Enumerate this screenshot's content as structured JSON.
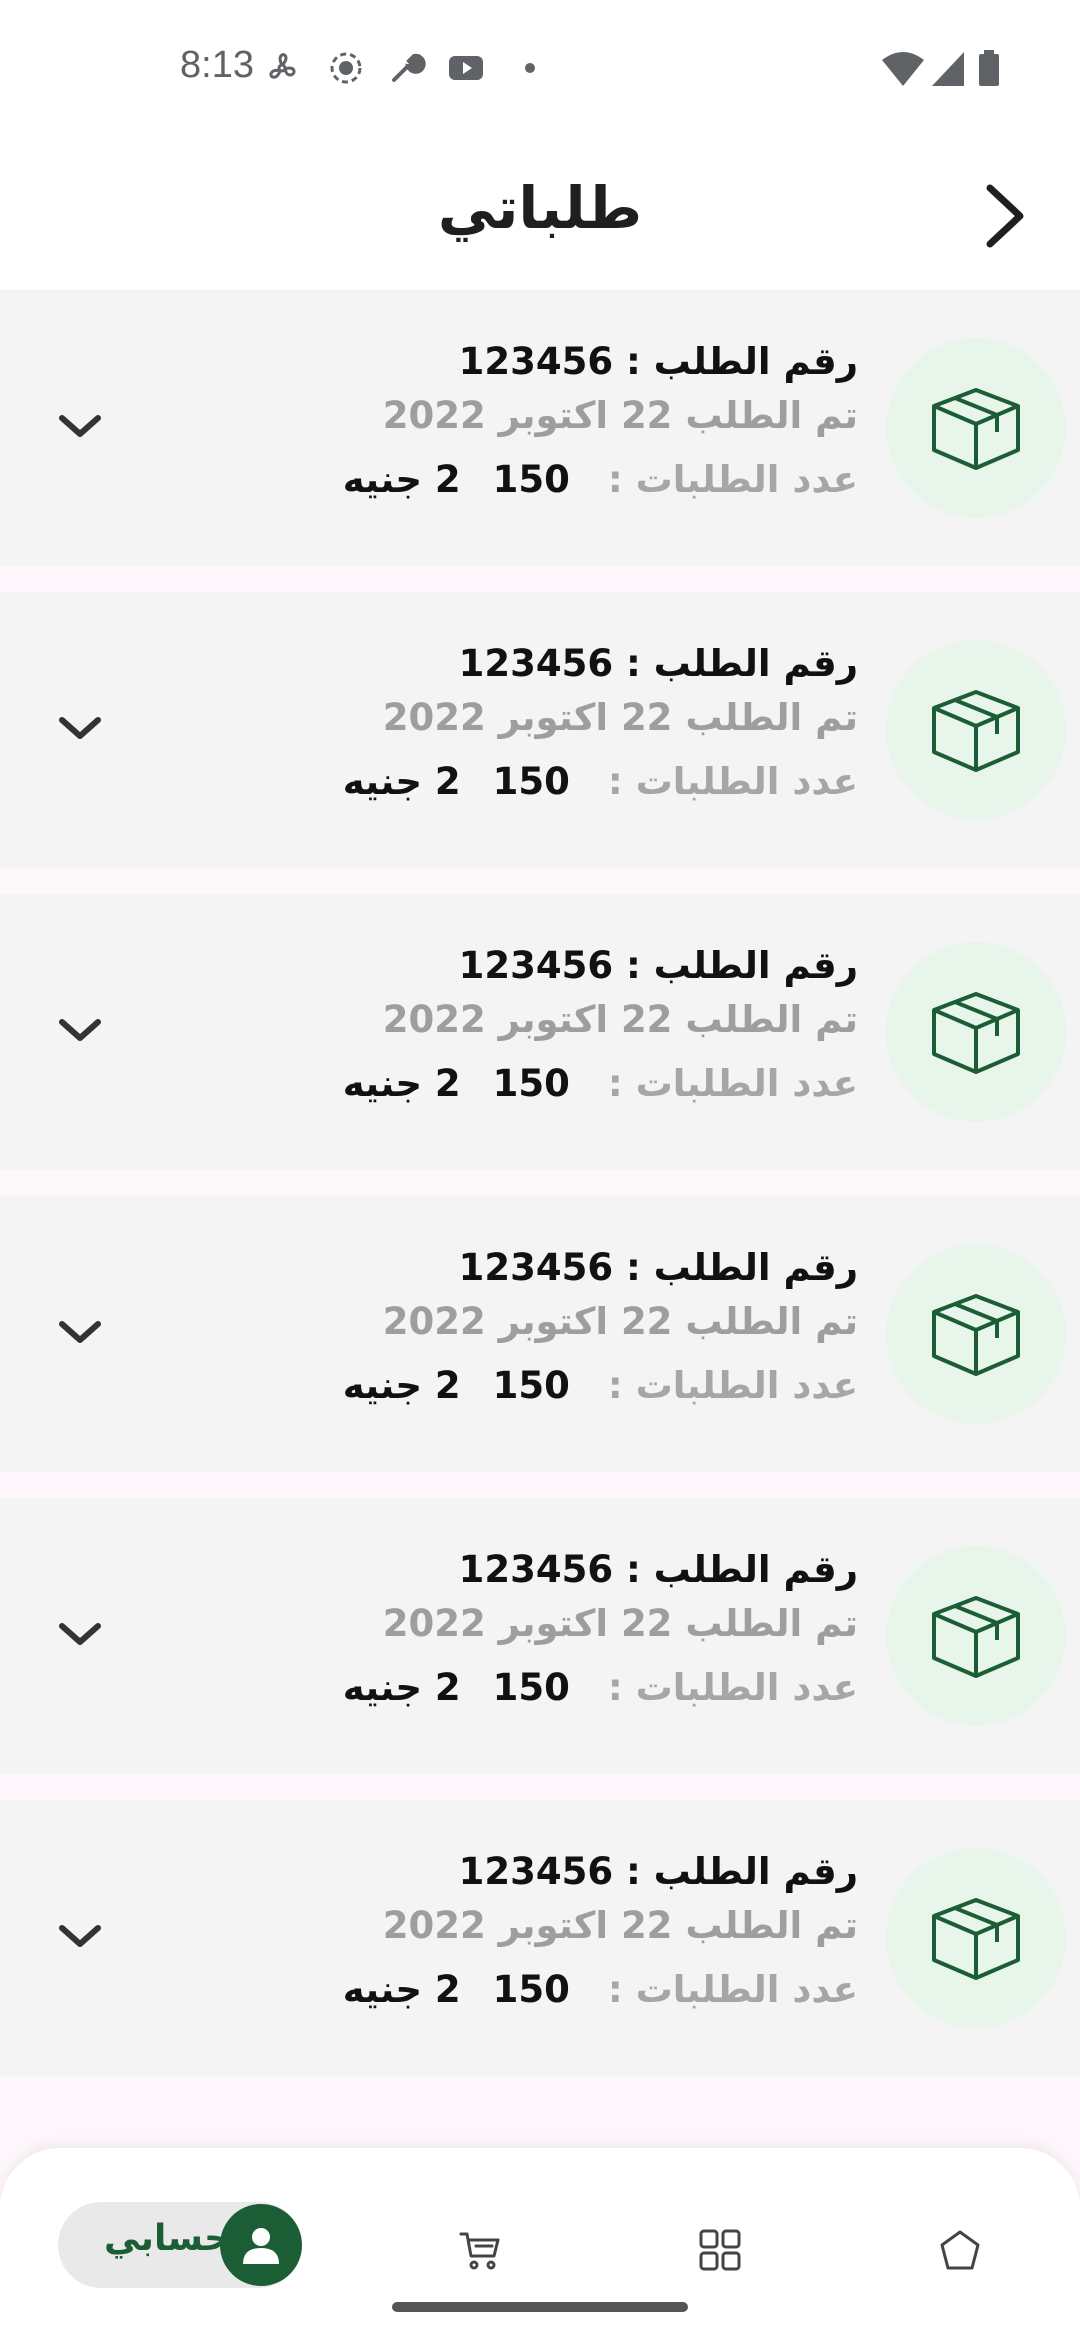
{
  "status_bar": {
    "time": "8:13"
  },
  "header": {
    "title": "طلباتي"
  },
  "orders": [
    {
      "number_text": "رقم الطلب : 123456",
      "date_text": "تم الطلب 22 اكتوبر 2022",
      "count_label": "عدد الطلبات :",
      "count": "2",
      "price": "150 جنيه"
    },
    {
      "number_text": "رقم الطلب : 123456",
      "date_text": "تم الطلب 22 اكتوبر 2022",
      "count_label": "عدد الطلبات :",
      "count": "2",
      "price": "150 جنيه"
    },
    {
      "number_text": "رقم الطلب : 123456",
      "date_text": "تم الطلب 22 اكتوبر 2022",
      "count_label": "عدد الطلبات :",
      "count": "2",
      "price": "150 جنيه"
    },
    {
      "number_text": "رقم الطلب : 123456",
      "date_text": "تم الطلب 22 اكتوبر 2022",
      "count_label": "عدد الطلبات :",
      "count": "2",
      "price": "150 جنيه"
    },
    {
      "number_text": "رقم الطلب : 123456",
      "date_text": "تم الطلب 22 اكتوبر 2022",
      "count_label": "عدد الطلبات :",
      "count": "2",
      "price": "150 جنيه"
    },
    {
      "number_text": "رقم الطلب : 123456",
      "date_text": "تم الطلب 22 اكتوبر 2022",
      "count_label": "عدد الطلبات :",
      "count": "2",
      "price": "150 جنيه"
    }
  ],
  "bottom_nav": {
    "account_label": "حسابي",
    "items": [
      "account-icon",
      "cart-icon",
      "categories-icon",
      "home-icon"
    ]
  },
  "colors": {
    "brand_green": "#1b5e35",
    "icon_bg": "#e8f5ea",
    "card_bg": "#f4f4f4"
  }
}
